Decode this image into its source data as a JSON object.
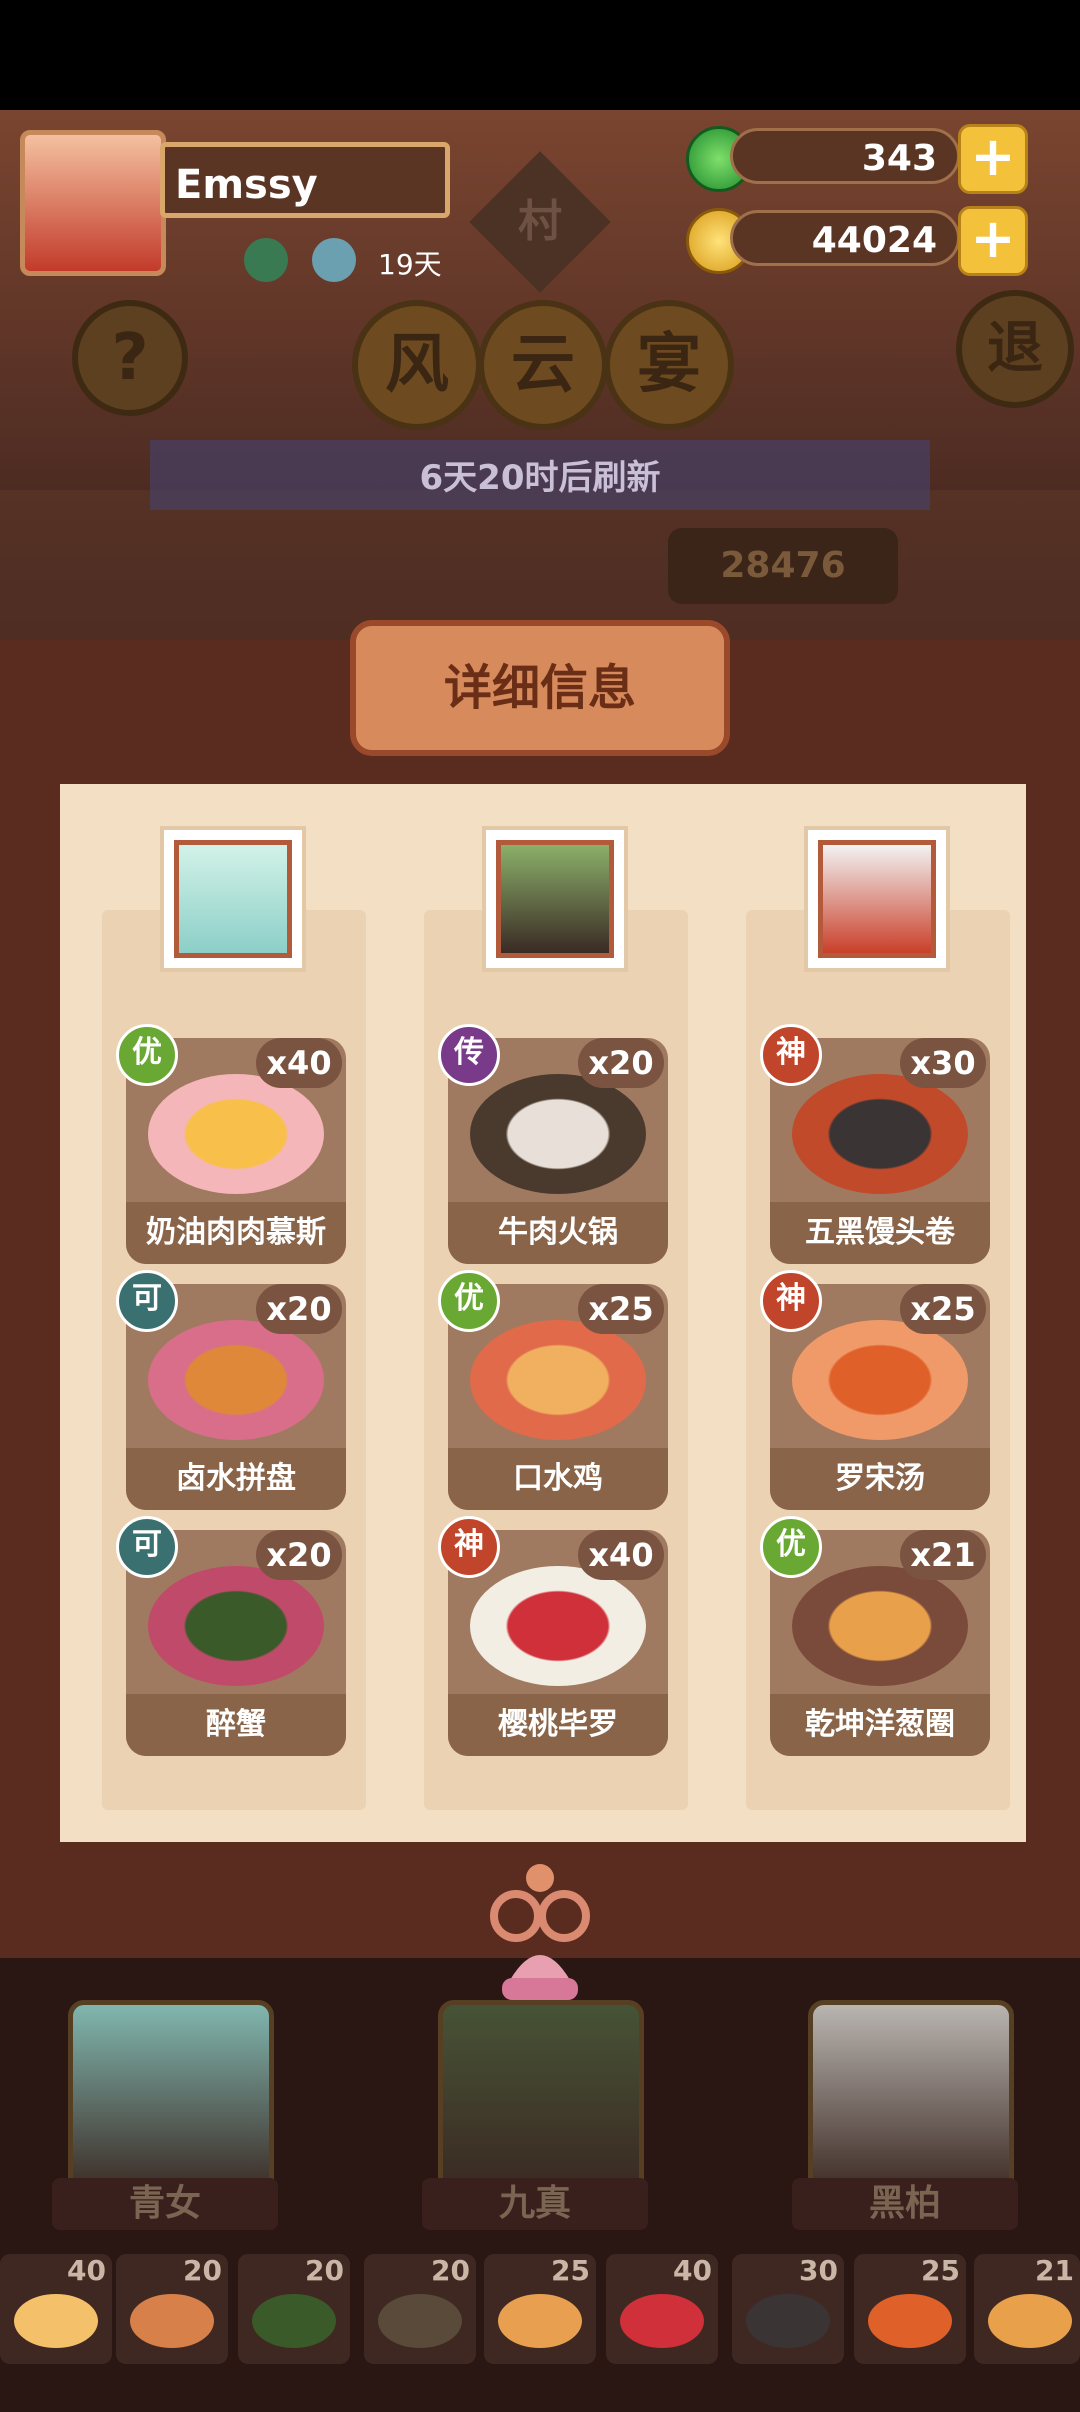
{
  "player": {
    "name": "Emssy",
    "days": "19天"
  },
  "resources": {
    "jade": "343",
    "coins": "44024"
  },
  "header": {
    "village_label": "村",
    "feast_chars": [
      "风",
      "云",
      "宴"
    ],
    "refresh_text": "6天20时后刷新",
    "score_partial": "28476",
    "help_label": "?",
    "exit_label": "退"
  },
  "detail": {
    "title": "详细信息",
    "columns": [
      {
        "dishes": [
          {
            "tier": "优",
            "qty": "x40",
            "name": "奶油肉肉慕斯"
          },
          {
            "tier": "可",
            "qty": "x20",
            "name": "卤水拼盘"
          },
          {
            "tier": "可",
            "qty": "x20",
            "name": "醉蟹"
          }
        ]
      },
      {
        "dishes": [
          {
            "tier": "传",
            "qty": "x20",
            "name": "牛肉火锅"
          },
          {
            "tier": "优",
            "qty": "x25",
            "name": "口水鸡"
          },
          {
            "tier": "神",
            "qty": "x40",
            "name": "樱桃毕罗"
          }
        ]
      },
      {
        "dishes": [
          {
            "tier": "神",
            "qty": "x30",
            "name": "五黑馒头卷"
          },
          {
            "tier": "神",
            "qty": "x25",
            "name": "罗宋汤"
          },
          {
            "tier": "优",
            "qty": "x21",
            "name": "乾坤洋葱圈"
          }
        ]
      }
    ]
  },
  "characters": [
    "青女",
    "九真",
    "黑柏"
  ],
  "dish_strip": [
    "40",
    "20",
    "20",
    "20",
    "25",
    "40",
    "30",
    "25",
    "21"
  ],
  "colors": {
    "tier_you": "#6aa834",
    "tier_chuan": "#7a3a8a",
    "tier_shen": "#c0452a",
    "tier_ke": "#3a7070",
    "gold": "#f4c23a"
  }
}
